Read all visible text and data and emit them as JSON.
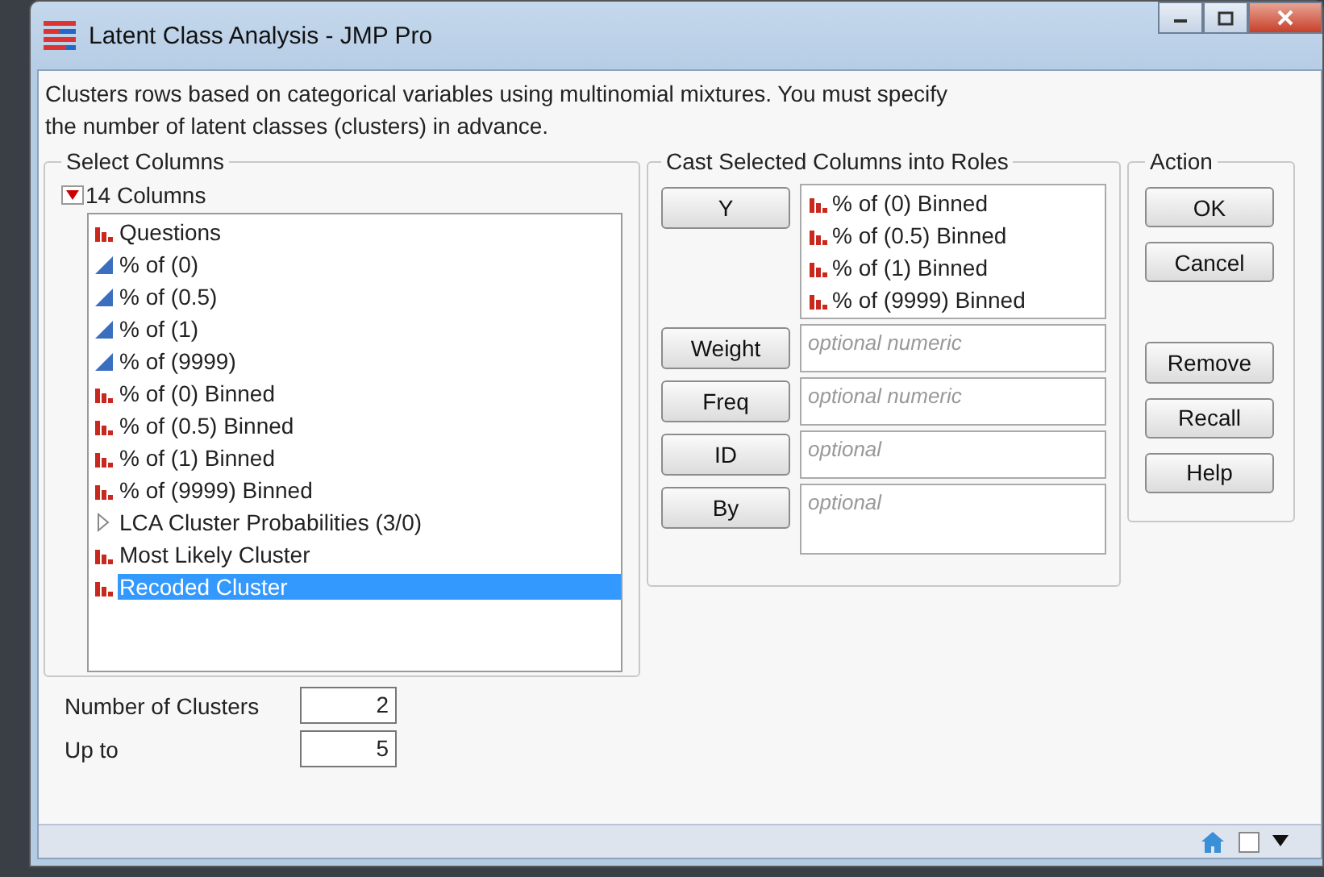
{
  "window": {
    "title": "Latent Class Analysis - JMP Pro"
  },
  "description": "Clusters rows based on categorical variables using multinomial mixtures.  You must specify the number of latent classes (clusters) in advance.",
  "select_columns": {
    "title": "Select Columns",
    "header": "14 Columns",
    "expanded": true,
    "columns": [
      {
        "label": "Questions",
        "kind": "nominal",
        "selected": false
      },
      {
        "label": "% of (0)",
        "kind": "continuous",
        "selected": false
      },
      {
        "label": "% of (0.5)",
        "kind": "continuous",
        "selected": false
      },
      {
        "label": "% of (1)",
        "kind": "continuous",
        "selected": false
      },
      {
        "label": "% of (9999)",
        "kind": "continuous",
        "selected": false
      },
      {
        "label": "% of (0) Binned",
        "kind": "nominal",
        "selected": false
      },
      {
        "label": "% of (0.5) Binned",
        "kind": "nominal",
        "selected": false
      },
      {
        "label": "% of (1) Binned",
        "kind": "nominal",
        "selected": false
      },
      {
        "label": "% of (9999) Binned",
        "kind": "nominal",
        "selected": false
      },
      {
        "label": "LCA Cluster Probabilities (3/0)",
        "kind": "group",
        "selected": false
      },
      {
        "label": "Most Likely Cluster",
        "kind": "nominal",
        "selected": false
      },
      {
        "label": "Recoded Cluster",
        "kind": "nominal",
        "selected": true
      }
    ]
  },
  "roles": {
    "title": "Cast Selected Columns into Roles",
    "rows": [
      {
        "button": "Y",
        "items": [
          {
            "label": "% of (0) Binned",
            "kind": "nominal"
          },
          {
            "label": "% of (0.5) Binned",
            "kind": "nominal"
          },
          {
            "label": "% of (1) Binned",
            "kind": "nominal"
          },
          {
            "label": "% of (9999) Binned",
            "kind": "nominal"
          }
        ]
      },
      {
        "button": "Weight",
        "placeholder": "optional numeric"
      },
      {
        "button": "Freq",
        "placeholder": "optional numeric"
      },
      {
        "button": "ID",
        "placeholder": "optional"
      },
      {
        "button": "By",
        "placeholder": "optional"
      }
    ]
  },
  "action": {
    "title": "Action",
    "button_groups": [
      [
        "OK",
        "Cancel"
      ],
      [
        "Remove",
        "Recall",
        "Help"
      ]
    ]
  },
  "options": [
    {
      "label": "Number of Clusters",
      "value": "2"
    },
    {
      "label": "Up to",
      "value": "5"
    }
  ],
  "status_bar": {
    "checked": false
  }
}
